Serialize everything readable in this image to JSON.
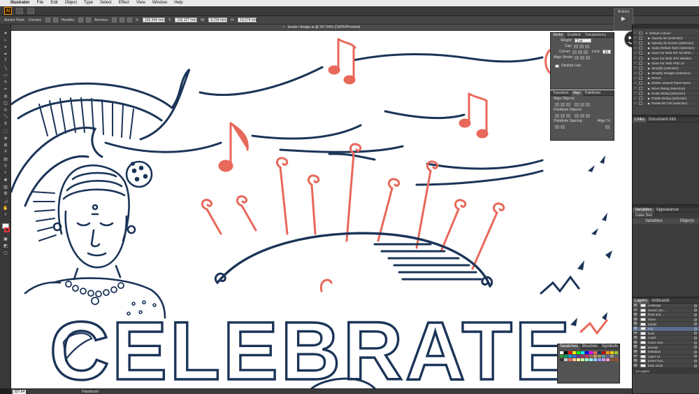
{
  "menubar": {
    "apple": "",
    "app": "Illustrator",
    "items": [
      "File",
      "Edit",
      "Object",
      "Type",
      "Select",
      "Effect",
      "View",
      "Window",
      "Help"
    ]
  },
  "topbar": {
    "logo": "Ai"
  },
  "control": {
    "tool_label": "Anchor Point",
    "convert_label": "Convert:",
    "handles_label": "Handles:",
    "anchors_label": "Anchors:",
    "x_label": "X:",
    "x_value": "143.344 mm",
    "y_label": "Y:",
    "y_value": "118.107 mm",
    "w_label": "W:",
    "w_value": "8.234 mm",
    "h_label": "H:",
    "h_value": "19.274 mm"
  },
  "document": {
    "tab_title": "kerala t design.ai @ 327.64% (CMYK/Preview)"
  },
  "canvas": {
    "artwork_text": "CELEBRATE"
  },
  "status": {
    "zoom": "327.64",
    "tool": "Paintbrush"
  },
  "actions_button": {
    "label": "Actions"
  },
  "stroke_panel": {
    "tabs": [
      "Stroke",
      "Gradient",
      "Transparency"
    ],
    "weight_label": "Weight:",
    "weight_value": "2 pt",
    "cap_label": "Cap:",
    "corner_label": "Corner:",
    "limit_label": "Limit:",
    "limit_value": "10",
    "align_label": "Align Stroke:",
    "dashed_label": "Dashed Line"
  },
  "align_panel": {
    "tabs": [
      "Transform",
      "Align",
      "Pathfinder"
    ],
    "align_objects": "Align Objects:",
    "distribute_objects": "Distribute Objects:",
    "distribute_spacing": "Distribute Spacing:",
    "align_to": "Align To:"
  },
  "actions_panel": {
    "items": [
      "Default Actions",
      "Opacity 60 (selection)",
      "Opacity 40 Screen (selection)",
      "Apply Default Style (selection)",
      "Save For Web GIF 64 Dithe...",
      "Save For Web JPG Medium",
      "Save For Web PNG 24",
      "Simplify (selection)",
      "Simplify Straight (selection)",
      "Revert",
      "Delete Unused Panel Items",
      "Move Dialog (selection)",
      "Scale Dialog (selection)",
      "Rotate Dialog (selection)",
      "Rotate 90 CW (selection)"
    ]
  },
  "links_panel": {
    "tabs": [
      "Links",
      "Document Info"
    ]
  },
  "variables_panel": {
    "tabs": [
      "Variables",
      "Appearance"
    ],
    "dataset_label": "Data Set:",
    "col_variables": "Variables",
    "col_objects": "Objects"
  },
  "layers_panel": {
    "tabs": [
      "Layers",
      "Artboards"
    ],
    "items": [
      "celebrate",
      "MUSIC BA...",
      "flesh and ...",
      "stone",
      "hands",
      "sun",
      "boat",
      "could",
      "music wav...",
      "woman",
      "kathakali",
      "Layer 14",
      "power hou...",
      "back circle"
    ],
    "count": "14 Layers"
  },
  "swatches_panel": {
    "tabs": [
      "Swatches",
      "Brushes",
      "Symbols"
    ]
  },
  "colors": {
    "navy": "#1b3458",
    "coral": "#e8685a",
    "chrome": "#535353"
  }
}
